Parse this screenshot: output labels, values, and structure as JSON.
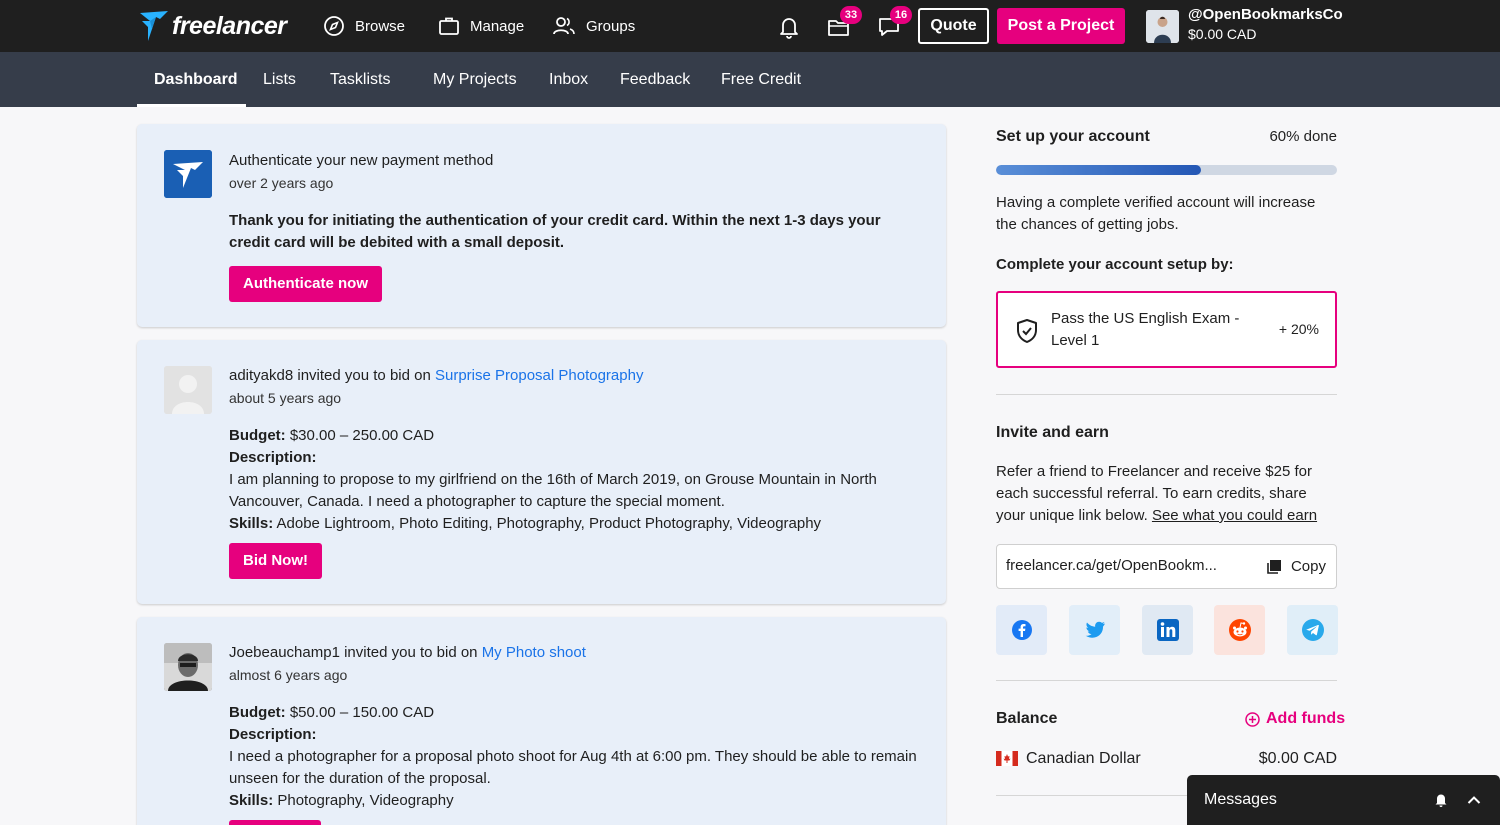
{
  "header": {
    "logo_text": "freelancer",
    "nav": [
      {
        "label": "Browse",
        "icon": "compass-icon"
      },
      {
        "label": "Manage",
        "icon": "briefcase-icon"
      },
      {
        "label": "Groups",
        "icon": "users-icon"
      }
    ],
    "projects_badge": "33",
    "messages_badge": "16",
    "quote_label": "Quote",
    "post_project_label": "Post a Project",
    "username": "@OpenBookmarksCo",
    "balance": "$0.00 CAD"
  },
  "subnav": {
    "items": [
      "Dashboard",
      "Lists",
      "Tasklists",
      "My Projects",
      "Inbox",
      "Feedback",
      "Free Credit"
    ],
    "active": "Dashboard"
  },
  "feed": {
    "card1": {
      "title": "Authenticate your new payment method",
      "time": "over 2 years ago",
      "message": "Thank you for initiating the authentication of your credit card. Within the next 1-3 days your credit card will be debited with a small deposit.",
      "button": "Authenticate now"
    },
    "card2": {
      "inviter": "adityakd8",
      "invite_text": " invited you to bid on ",
      "project": "Surprise Proposal Photography",
      "time": "about 5 years ago",
      "budget_label": "Budget:",
      "budget": " $30.00 – 250.00 CAD",
      "description_label": "Description:",
      "description": "I am planning to propose to my girlfriend on the 16th of March 2019, on Grouse Mountain in North Vancouver, Canada. I need a photographer to capture the special moment.",
      "skills_label": "Skills:",
      "skills": " Adobe Lightroom, Photo Editing, Photography, Product Photography, Videography",
      "button": "Bid Now!"
    },
    "card3": {
      "inviter": "Joebeauchamp1",
      "invite_text": " invited you to bid on ",
      "project": "My Photo shoot",
      "time": "almost 6 years ago",
      "budget_label": "Budget:",
      "budget": " $50.00 – 150.00 CAD",
      "description_label": "Description:",
      "description": "I need a photographer for a proposal photo shoot for Aug 4th at 6:00 pm. They should be able to remain unseen for the duration of the proposal.",
      "skills_label": "Skills:",
      "skills": " Photography, Videography"
    }
  },
  "sidebar": {
    "setup": {
      "title": "Set up your account",
      "progress_label": "60% done",
      "progress": 0.6,
      "text": "Having a complete verified account will increase the chances of getting jobs.",
      "complete_by": "Complete your account setup by:",
      "task": "Pass the US English Exam - Level 1",
      "task_bonus": "+ 20%"
    },
    "invite": {
      "title": "Invite and earn",
      "text": "Refer a friend to Freelancer and receive $25 for each successful referral. To earn credits, share your unique link below. ",
      "link_text": "See what you could earn",
      "url": "freelancer.ca/get/OpenBookm...",
      "copy_label": "Copy",
      "share": [
        "facebook-icon",
        "twitter-icon",
        "linkedin-icon",
        "reddit-icon",
        "telegram-icon"
      ]
    },
    "balance": {
      "title": "Balance",
      "add_funds": "Add funds",
      "currency": "Canadian Dollar",
      "amount": "$0.00 CAD"
    }
  },
  "messages": {
    "label": "Messages"
  },
  "colors": {
    "brand_pink": "#e6007e",
    "header_bg": "#1f1f1f",
    "subnav_bg": "#363d4a",
    "link_blue": "#1a73e8",
    "card_bg": "#e8eff9"
  }
}
